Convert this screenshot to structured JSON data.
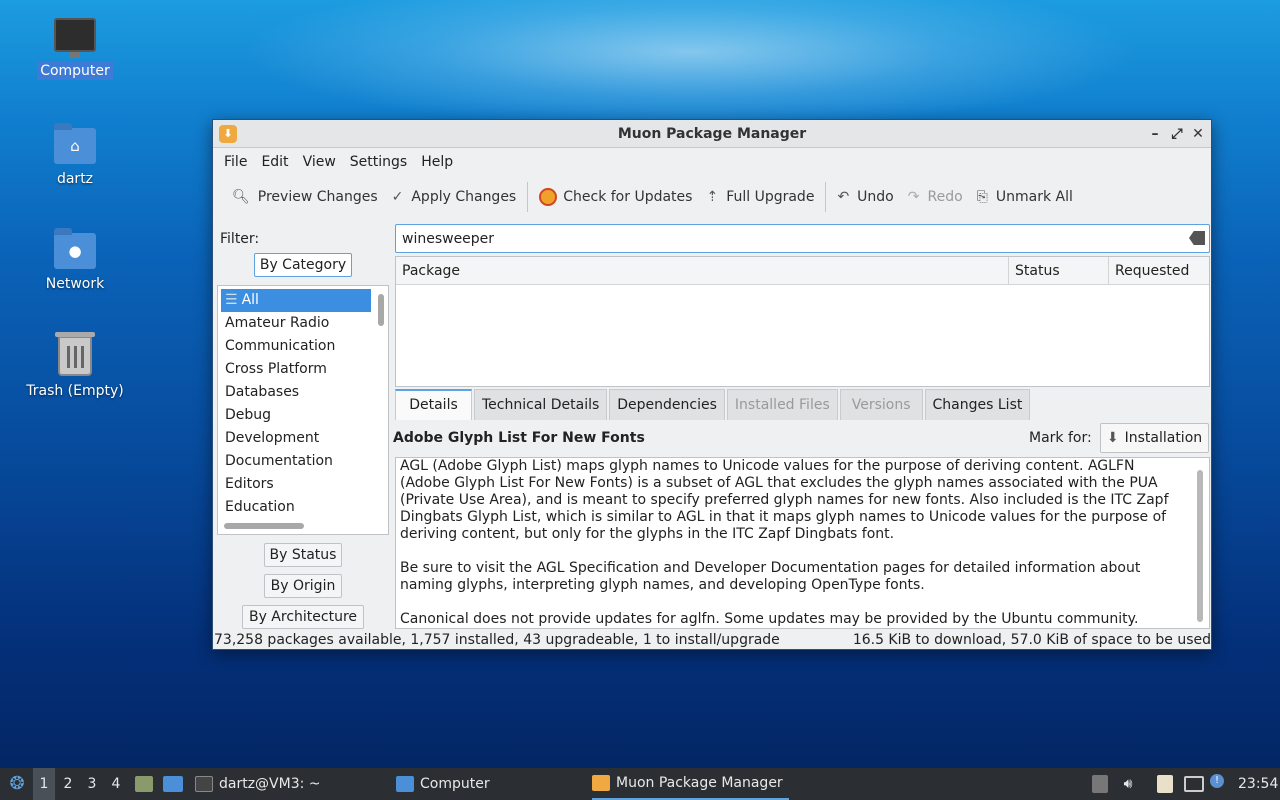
{
  "desktop": {
    "icons": [
      {
        "label": "Computer"
      },
      {
        "label": "dartz"
      },
      {
        "label": "Network"
      },
      {
        "label": "Trash (Empty)"
      }
    ]
  },
  "window": {
    "title": "Muon Package Manager",
    "menu": [
      "File",
      "Edit",
      "View",
      "Settings",
      "Help"
    ],
    "toolbar": {
      "preview": "Preview Changes",
      "apply": "Apply Changes",
      "check": "Check for Updates",
      "upgrade": "Full Upgrade",
      "undo": "Undo",
      "redo": "Redo",
      "unmark": "Unmark All"
    },
    "filter": {
      "label": "Filter:",
      "by_category": "By Category",
      "by_status": "By Status",
      "by_origin": "By Origin",
      "by_architecture": "By Architecture",
      "categories": [
        "All",
        "Amateur Radio",
        "Communication",
        "Cross Platform",
        "Databases",
        "Debug",
        "Development",
        "Documentation",
        "Editors",
        "Education"
      ]
    },
    "search": {
      "value": "winesweeper"
    },
    "table": {
      "columns": [
        "Package",
        "Status",
        "Requested"
      ]
    },
    "detail_tabs": [
      "Details",
      "Technical Details",
      "Dependencies",
      "Installed Files",
      "Versions",
      "Changes List"
    ],
    "details": {
      "title": "Adobe Glyph List For New Fonts",
      "mark_for_label": "Mark for:",
      "mark_button": "Installation",
      "paragraphs": [
        "AGL (Adobe Glyph List) maps glyph names to Unicode values for the purpose of deriving content. AGLFN (Adobe Glyph List For New Fonts) is a subset of AGL that excludes the glyph names associated with the PUA (Private Use Area), and is meant to specify preferred glyph names for new fonts. Also included is the ITC Zapf Dingbats Glyph List, which is similar to AGL in that it maps glyph names to Unicode values for the purpose of deriving content, but only for the glyphs in the ITC Zapf Dingbats font.",
        "Be sure to visit the AGL Specification and Developer Documentation pages for detailed information about naming glyphs, interpreting glyph names, and developing OpenType fonts.",
        "Canonical does not provide updates for aglfn. Some updates may be provided by the Ubuntu community."
      ]
    },
    "status": {
      "left": "73,258 packages available, 1,757 installed, 43 upgradeable, 1 to install/upgrade",
      "right": "16.5 KiB to download, 57.0 KiB of space to be used"
    }
  },
  "taskbar": {
    "workspaces": [
      "1",
      "2",
      "3",
      "4"
    ],
    "tasks": [
      "dartz@VM3: ~",
      "Computer",
      "Muon Package Manager"
    ],
    "clock": "23:54"
  }
}
